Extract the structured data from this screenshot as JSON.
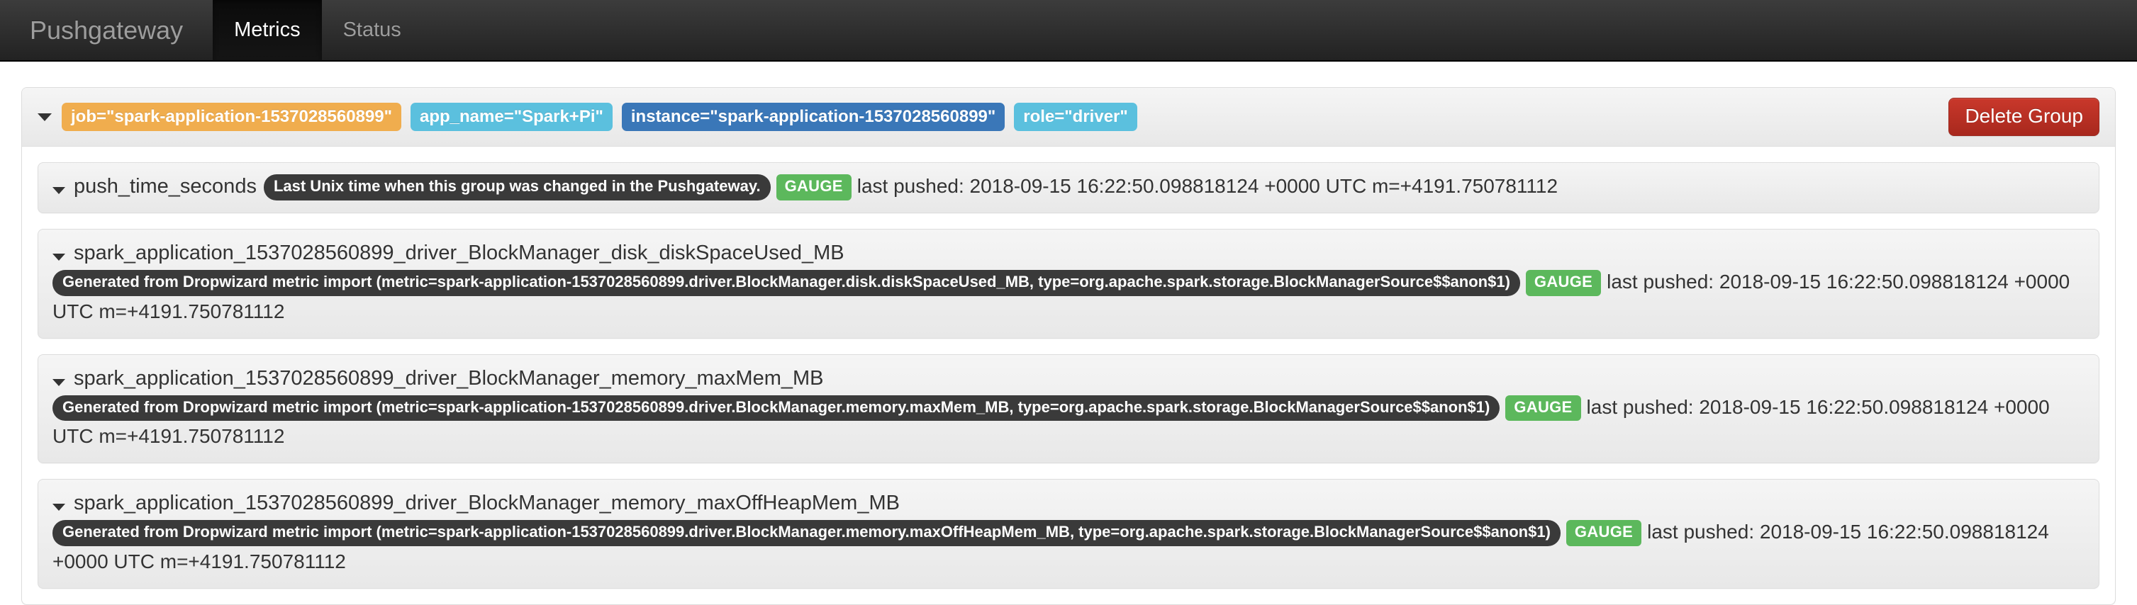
{
  "navbar": {
    "brand": "Pushgateway",
    "items": [
      {
        "label": "Metrics",
        "active": true
      },
      {
        "label": "Status",
        "active": false
      }
    ]
  },
  "group": {
    "labels": [
      {
        "text": "job=\"spark-application-1537028560899\"",
        "style": "warning"
      },
      {
        "text": "app_name=\"Spark+Pi\"",
        "style": "info"
      },
      {
        "text": "instance=\"spark-application-1537028560899\"",
        "style": "primary"
      },
      {
        "text": "role=\"driver\"",
        "style": "info"
      }
    ],
    "delete_button": "Delete Group",
    "metrics": [
      {
        "name": "push_time_seconds",
        "help": "Last Unix time when this group was changed in the Pushgateway.",
        "type": "GAUGE",
        "last_pushed": "last pushed: 2018-09-15 16:22:50.098818124 +0000 UTC m=+4191.750781112"
      },
      {
        "name": "spark_application_1537028560899_driver_BlockManager_disk_diskSpaceUsed_MB",
        "help": "Generated from Dropwizard metric import (metric=spark-application-1537028560899.driver.BlockManager.disk.diskSpaceUsed_MB, type=org.apache.spark.storage.BlockManagerSource$$anon$1)",
        "type": "GAUGE",
        "last_pushed": "last pushed: 2018-09-15 16:22:50.098818124 +0000 UTC m=+4191.750781112"
      },
      {
        "name": "spark_application_1537028560899_driver_BlockManager_memory_maxMem_MB",
        "help": "Generated from Dropwizard metric import (metric=spark-application-1537028560899.driver.BlockManager.memory.maxMem_MB, type=org.apache.spark.storage.BlockManagerSource$$anon$1)",
        "type": "GAUGE",
        "last_pushed": "last pushed: 2018-09-15 16:22:50.098818124 +0000 UTC m=+4191.750781112"
      },
      {
        "name": "spark_application_1537028560899_driver_BlockManager_memory_maxOffHeapMem_MB",
        "help": "Generated from Dropwizard metric import (metric=spark-application-1537028560899.driver.BlockManager.memory.maxOffHeapMem_MB, type=org.apache.spark.storage.BlockManagerSource$$anon$1)",
        "type": "GAUGE",
        "last_pushed": "last pushed: 2018-09-15 16:22:50.098818124 +0000 UTC m=+4191.750781112"
      }
    ]
  },
  "colors": {
    "navbar_bg": "#222222",
    "label_warning": "#f0ad4e",
    "label_info": "#5bc0de",
    "label_primary": "#3a77b8",
    "type_badge": "#5cb85c",
    "help_badge": "#3a3a3a",
    "danger": "#a8281d"
  }
}
